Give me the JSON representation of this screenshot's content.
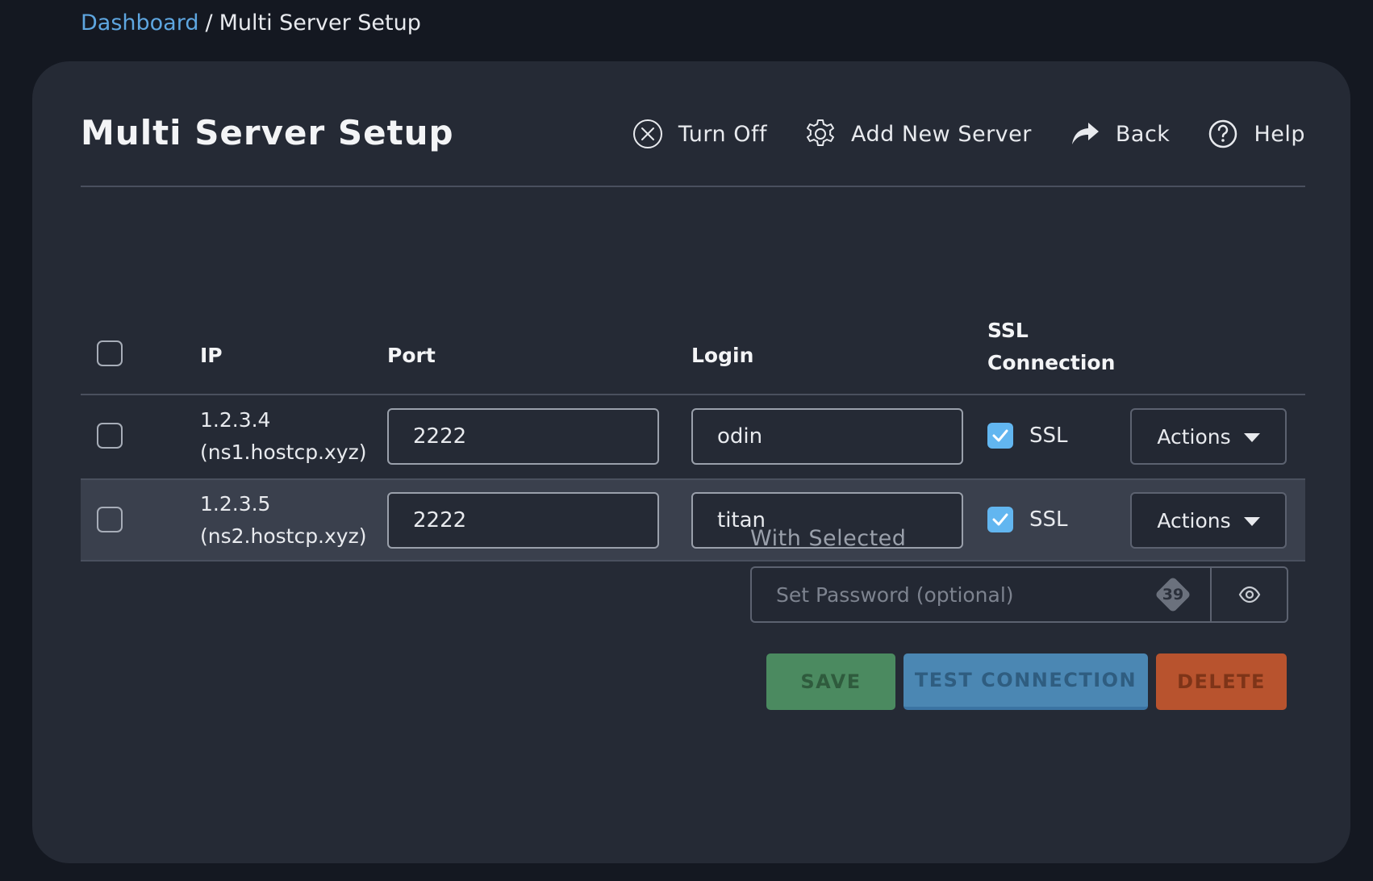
{
  "breadcrumb": {
    "link": "Dashboard",
    "separator": "/",
    "current": "Multi Server Setup"
  },
  "page": {
    "title": "Multi Server Setup"
  },
  "toolbar": {
    "turn_off": "Turn Off",
    "add_new_server": "Add New Server",
    "back": "Back",
    "help": "Help"
  },
  "table": {
    "headers": {
      "ip": "IP",
      "port": "Port",
      "login": "Login",
      "ssl_line1": "SSL",
      "ssl_line2": "Connection"
    },
    "rows": [
      {
        "ip": "1.2.3.4",
        "host": "(ns1.hostcp.xyz)",
        "port": "2222",
        "login": "odin",
        "ssl_checked": true,
        "ssl_label": "SSL",
        "actions_label": "Actions"
      },
      {
        "ip": "1.2.3.5",
        "host": "(ns2.hostcp.xyz)",
        "port": "2222",
        "login": "titan",
        "ssl_checked": true,
        "ssl_label": "SSL",
        "actions_label": "Actions"
      }
    ]
  },
  "bulk": {
    "label": "With Selected",
    "password_placeholder": "Set Password (optional)",
    "password_badge": "39",
    "save": "SAVE",
    "test_connection": "TEST CONNECTION",
    "delete": "DELETE"
  },
  "colors": {
    "background": "#141821",
    "panel": "#252a35",
    "accent_link": "#5ea6e0",
    "checkbox_checked": "#62b6f0",
    "save": "#4b8a60",
    "test": "#4b87b3",
    "delete": "#b8532e"
  },
  "icons": {
    "turn_off": "circle-x-icon",
    "add_new_server": "gear-icon",
    "back": "share-arrow-icon",
    "help": "question-circle-icon",
    "password_toggle": "eye-icon",
    "actions": "caret-down-icon"
  }
}
